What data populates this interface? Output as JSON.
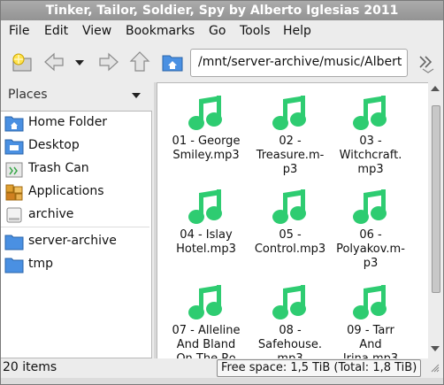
{
  "window": {
    "title": "Tinker, Tailor, Soldier, Spy by Alberto Iglesias 2011"
  },
  "menu": [
    {
      "label": "File"
    },
    {
      "label": "Edit"
    },
    {
      "label": "View"
    },
    {
      "label": "Bookmarks"
    },
    {
      "label": "Go"
    },
    {
      "label": "Tools"
    },
    {
      "label": "Help"
    }
  ],
  "toolbar": {
    "new_tab_icon": "new-tab-icon",
    "back_icon": "back-arrow-icon",
    "history_icon": "chevron-down-icon",
    "forward_icon": "forward-arrow-icon",
    "up_icon": "up-arrow-icon",
    "home_icon": "home-folder-icon",
    "path": "/mnt/server-archive/music/Albert",
    "go_icon": "go-arrow-icon"
  },
  "sidebar": {
    "title": "Places",
    "items": [
      {
        "label": "Home Folder",
        "icon": "home-folder-icon"
      },
      {
        "label": "Desktop",
        "icon": "desktop-folder-icon"
      },
      {
        "label": "Trash Can",
        "icon": "trash-icon"
      },
      {
        "label": "Applications",
        "icon": "applications-icon"
      },
      {
        "label": "archive",
        "icon": "drive-icon"
      }
    ],
    "bookmarks": [
      {
        "label": "server-archive",
        "icon": "folder-icon"
      },
      {
        "label": "tmp",
        "icon": "folder-icon"
      }
    ]
  },
  "files": [
    {
      "name": "01 - George\nSmiley.mp3"
    },
    {
      "name": "02 -\nTreasure.m-\np3"
    },
    {
      "name": "03 -\nWitchcraft.\nmp3"
    },
    {
      "name": "04 - Islay\nHotel.mp3"
    },
    {
      "name": "05 -\nControl.mp3"
    },
    {
      "name": "06 -\nPolyakov.m-\np3"
    },
    {
      "name": "07 - Alleline\nAnd Bland\nOn The Ro"
    },
    {
      "name": "08 -\nSafehouse.\nmp3"
    },
    {
      "name": "09 - Tarr\nAnd\nIrina.mp3"
    }
  ],
  "colors": {
    "music_icon": "#2ecc71",
    "folder": "#3a82d4",
    "titlebar": "#9e9e9e"
  },
  "status": {
    "count": "20 items",
    "free_space": "Free space: 1,5 TiB (Total: 1,8 TiB)"
  }
}
